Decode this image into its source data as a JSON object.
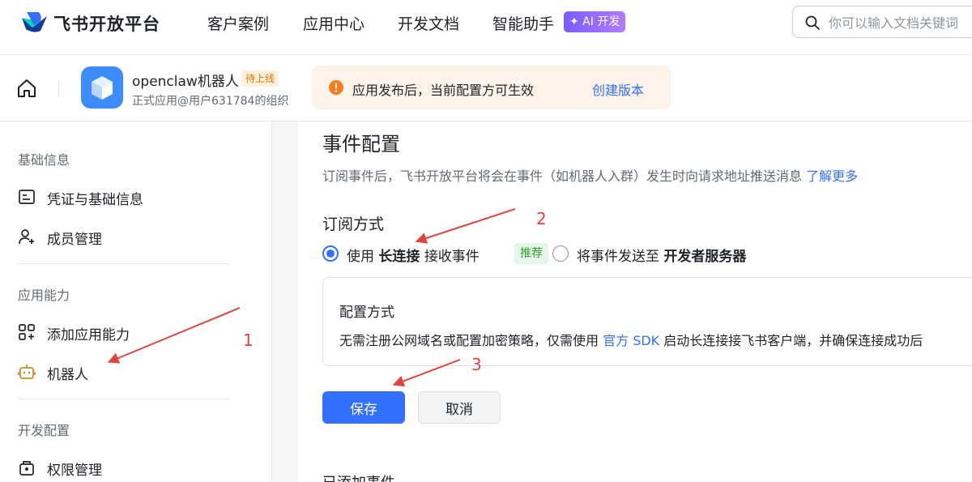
{
  "topnav": {
    "brand": "飞书开放平台",
    "items": [
      {
        "label": "客户案例"
      },
      {
        "label": "应用中心"
      },
      {
        "label": "开发文档"
      },
      {
        "label": "智能助手"
      }
    ],
    "ai_badge": "✦ AI 开发",
    "search_placeholder": "你可以输入文档关键词"
  },
  "appbar": {
    "app_name": "openclaw机器人",
    "status": "待上线",
    "org": "正式应用@用户631784的组织",
    "notice_text": "应用发布后，当前配置方可生效",
    "notice_link": "创建版本"
  },
  "sidebar": {
    "groups": [
      {
        "label": "基础信息",
        "items": [
          {
            "label": "凭证与基础信息",
            "icon": "credential-icon"
          },
          {
            "label": "成员管理",
            "icon": "member-add-icon"
          }
        ]
      },
      {
        "label": "应用能力",
        "items": [
          {
            "label": "添加应用能力",
            "icon": "add-capability-icon"
          },
          {
            "label": "机器人",
            "icon": "robot-icon"
          }
        ]
      },
      {
        "label": "开发配置",
        "items": [
          {
            "label": "权限管理",
            "icon": "permission-icon"
          }
        ]
      }
    ]
  },
  "main": {
    "title": "事件配置",
    "desc": "订阅事件后，飞书开放平台将会在事件（如机器人入群）发生时向请求地址推送消息",
    "desc_link": "了解更多",
    "subscribe_title": "订阅方式",
    "option1": {
      "prefix": "使用",
      "bold": "长连接",
      "suffix": "接收事件",
      "badge": "推荐",
      "selected": true
    },
    "option2": {
      "prefix": "将事件发送至",
      "bold": "开发者服务器",
      "selected": false
    },
    "config_title": "配置方式",
    "config_text_1": "无需注册公网域名或配置加密策略，仅需使用",
    "config_link": "官方 SDK",
    "config_text_2": "启动长连接接飞书客户端，并确保连接成功后",
    "save_label": "保存",
    "cancel_label": "取消",
    "next_section": "已添加事件"
  },
  "annotations": [
    "1",
    "2",
    "3"
  ],
  "colors": {
    "accent": "#3370ff",
    "annotation": "#e0443e",
    "warning": "#f57f1c",
    "success": "#2ea121"
  }
}
